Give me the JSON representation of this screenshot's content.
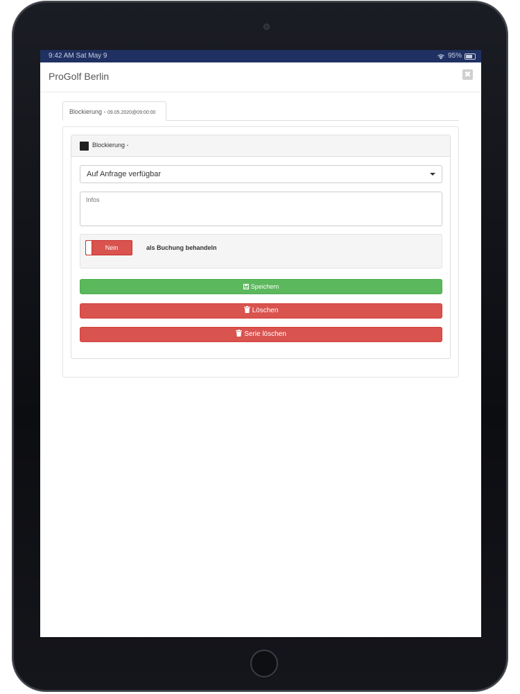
{
  "statusbar": {
    "time": "9:42 AM   Sat May 9",
    "battery": "95%"
  },
  "modal": {
    "title": "ProGolf Berlin",
    "close_icon": "✖"
  },
  "tab": {
    "label": "Blockierung - ",
    "date": "09.05.2020@09:00:00"
  },
  "panel": {
    "heading": "Blockierung -",
    "swatch_color": "#1f1f1f"
  },
  "form": {
    "availability_selected": "Auf Anfrage verfügbar",
    "infos_placeholder": "Infos",
    "toggle_label": "Nein",
    "toggle_description": "als Buchung behandeln"
  },
  "buttons": {
    "save": "Speichern",
    "delete": "Löschen",
    "delete_series": "Serie löschen"
  },
  "colors": {
    "save": "#5cb85c",
    "delete": "#d9534f",
    "statusbar": "#1f3062"
  },
  "icons": {
    "save": "floppy-disk-icon",
    "delete": "trash-icon"
  }
}
